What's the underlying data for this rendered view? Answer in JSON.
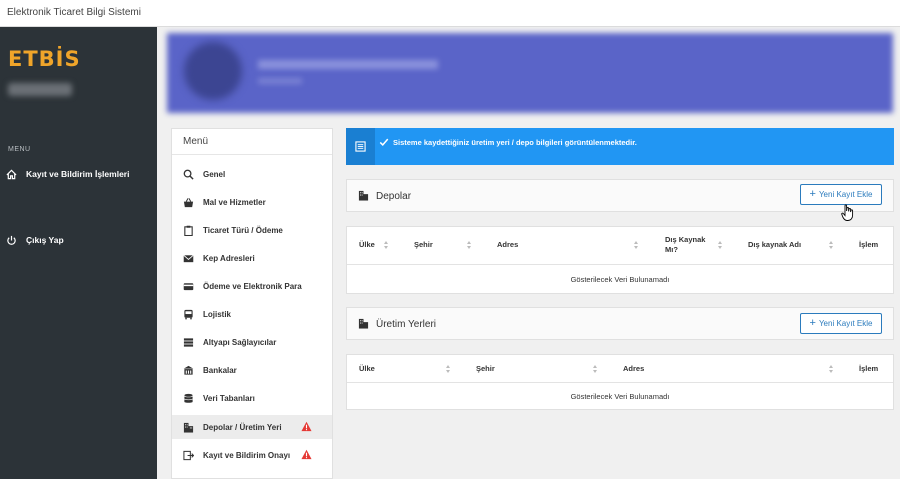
{
  "window": {
    "title": "Elektronik Ticaret Bilgi Sistemi"
  },
  "sidebar": {
    "logo": "ETBİS",
    "menu_caption": "MENU",
    "items": [
      {
        "label": "Kayıt ve Bildirim İşlemleri",
        "icon": "home-icon"
      },
      {
        "label": "Çıkış Yap",
        "icon": "power-icon"
      }
    ]
  },
  "menu": {
    "title": "Menü",
    "items": [
      {
        "label": "Genel",
        "icon": "search-icon"
      },
      {
        "label": "Mal ve Hizmetler",
        "icon": "basket-icon"
      },
      {
        "label": "Ticaret Türü / Ödeme",
        "icon": "clipboard-icon"
      },
      {
        "label": "Kep Adresleri",
        "icon": "envelope-icon"
      },
      {
        "label": "Ödeme ve Elektronik Para",
        "icon": "credit-card-icon"
      },
      {
        "label": "Lojistik",
        "icon": "bus-icon"
      },
      {
        "label": "Altyapı Sağlayıcılar",
        "icon": "stack-icon"
      },
      {
        "label": "Bankalar",
        "icon": "bank-icon"
      },
      {
        "label": "Veri Tabanları",
        "icon": "database-icon"
      },
      {
        "label": "Depolar / Üretim Yeri",
        "icon": "building-icon",
        "warning": true,
        "active": true
      },
      {
        "label": "Kayıt ve Bildirim Onayı",
        "icon": "sign-in-icon",
        "warning": true
      }
    ]
  },
  "alert": {
    "text": "Sisteme kaydettiğiniz üretim yeri / depo bilgileri görüntülenmektedir.",
    "color": "#2196f3"
  },
  "depolar": {
    "title": "Depolar",
    "add_label": "Yeni Kayıt Ekle",
    "columns": [
      "Ülke",
      "Şehir",
      "Adres",
      "Dış Kaynak Mı?",
      "Dış kaynak Adı",
      "İşlem"
    ],
    "empty_text": "Gösterilecek Veri Bulunamadı"
  },
  "uretim": {
    "title": "Üretim Yerleri",
    "add_label": "Yeni Kayıt Ekle",
    "columns": [
      "Ülke",
      "Şehir",
      "Adres",
      "İşlem"
    ],
    "empty_text": "Gösterilecek Veri Bulunamadı"
  },
  "colors": {
    "accent": "#2b7bbd",
    "logo": "#f0a52a",
    "sidebar": "#2c3338",
    "warning": "#e53935"
  }
}
